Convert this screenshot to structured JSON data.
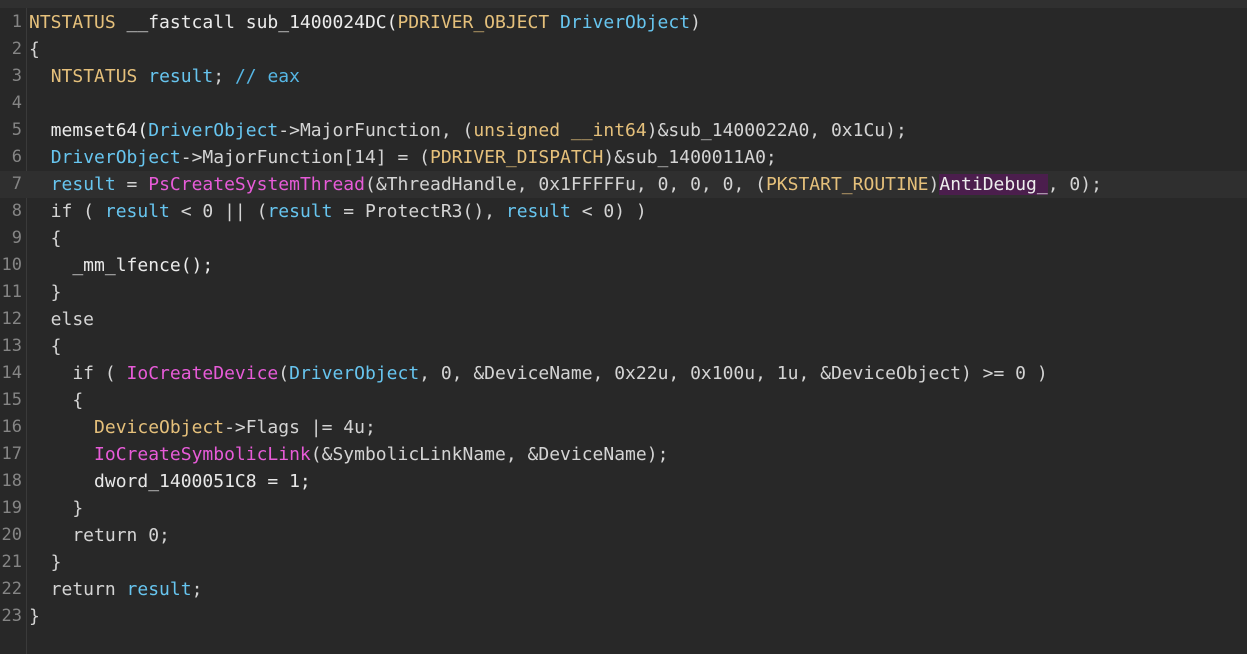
{
  "window": {
    "top_strip_text": "                  _                                                                 _                                                      ·                _             _"
  },
  "editor": {
    "current_line": 7,
    "colors": {
      "background": "#282828",
      "type": "#e5c07b",
      "local_variable": "#67c5ef",
      "import": "#e75bd8",
      "comment": "#56b6e4",
      "highlight": "#4b1e4d",
      "plain": "#d4d4d4"
    },
    "lines": [
      {
        "n": "1",
        "segs": [
          [
            "NTSTATUS",
            "typ"
          ],
          [
            " __fastcall sub_1400024DC(",
            "fn"
          ],
          [
            "PDRIVER_OBJECT",
            "typ"
          ],
          [
            " DriverObject",
            "arg"
          ],
          [
            ")",
            "pl"
          ]
        ]
      },
      {
        "n": "2",
        "segs": [
          [
            "{",
            "pl"
          ]
        ]
      },
      {
        "n": "3",
        "segs": [
          [
            "  ",
            "pl"
          ],
          [
            "NTSTATUS",
            "typ"
          ],
          [
            " result",
            "loc"
          ],
          [
            "; ",
            "pl"
          ],
          [
            "// eax",
            "cm"
          ]
        ]
      },
      {
        "n": "4",
        "segs": [
          [
            "",
            "pl"
          ]
        ]
      },
      {
        "n": "5",
        "segs": [
          [
            "  memset64(",
            "fn"
          ],
          [
            "DriverObject",
            "arg"
          ],
          [
            "->MajorFunction, (",
            "pl"
          ],
          [
            "unsigned __int64",
            "typ"
          ],
          [
            ")&sub_1400022A0, 0x1Cu);",
            "pl"
          ]
        ]
      },
      {
        "n": "6",
        "segs": [
          [
            "  ",
            "pl"
          ],
          [
            "DriverObject",
            "arg"
          ],
          [
            "->MajorFunction[14] = (",
            "pl"
          ],
          [
            "PDRIVER_DISPATCH",
            "typ"
          ],
          [
            ")&sub_1400011A0;",
            "pl"
          ]
        ]
      },
      {
        "n": "7",
        "segs": [
          [
            "  ",
            "pl"
          ],
          [
            "result",
            "loc"
          ],
          [
            " = ",
            "pl"
          ],
          [
            "PsCreateSystemThread",
            "imp"
          ],
          [
            "(&ThreadHandle, 0x1FFFFFu, 0, 0, 0, (",
            "pl"
          ],
          [
            "PKSTART_ROUTINE",
            "typ"
          ],
          [
            ")",
            "pl"
          ],
          [
            "AntiDebug_",
            "hl"
          ],
          [
            ", 0);",
            "pl"
          ]
        ]
      },
      {
        "n": "8",
        "segs": [
          [
            "  if ( ",
            "kw"
          ],
          [
            "result",
            "loc"
          ],
          [
            " < 0 || (",
            "pl"
          ],
          [
            "result",
            "loc"
          ],
          [
            " = ProtectR3(), ",
            "pl"
          ],
          [
            "result",
            "loc"
          ],
          [
            " < 0) )",
            "pl"
          ]
        ]
      },
      {
        "n": "9",
        "segs": [
          [
            "  {",
            "pl"
          ]
        ]
      },
      {
        "n": "10",
        "segs": [
          [
            "    _mm_lfence();",
            "fn"
          ]
        ]
      },
      {
        "n": "11",
        "segs": [
          [
            "  }",
            "pl"
          ]
        ]
      },
      {
        "n": "12",
        "segs": [
          [
            "  else",
            "kw"
          ]
        ]
      },
      {
        "n": "13",
        "segs": [
          [
            "  {",
            "pl"
          ]
        ]
      },
      {
        "n": "14",
        "segs": [
          [
            "    if ( ",
            "kw"
          ],
          [
            "IoCreateDevice",
            "imp"
          ],
          [
            "(",
            "pl"
          ],
          [
            "DriverObject",
            "arg"
          ],
          [
            ", 0, &DeviceName, 0x22u, 0x100u, 1u, &DeviceObject) >= 0 )",
            "pl"
          ]
        ]
      },
      {
        "n": "15",
        "segs": [
          [
            "    {",
            "pl"
          ]
        ]
      },
      {
        "n": "16",
        "segs": [
          [
            "      ",
            "pl"
          ],
          [
            "DeviceObject",
            "typ"
          ],
          [
            "->Flags |= 4u;",
            "pl"
          ]
        ]
      },
      {
        "n": "17",
        "segs": [
          [
            "      ",
            "pl"
          ],
          [
            "IoCreateSymbolicLink",
            "imp"
          ],
          [
            "(&SymbolicLinkName, &DeviceName);",
            "pl"
          ]
        ]
      },
      {
        "n": "18",
        "segs": [
          [
            "      dword_1400051C8 = 1;",
            "glob"
          ]
        ]
      },
      {
        "n": "19",
        "segs": [
          [
            "    }",
            "pl"
          ]
        ]
      },
      {
        "n": "20",
        "segs": [
          [
            "    return 0;",
            "kw"
          ]
        ]
      },
      {
        "n": "21",
        "segs": [
          [
            "  }",
            "pl"
          ]
        ]
      },
      {
        "n": "22",
        "segs": [
          [
            "  return ",
            "kw"
          ],
          [
            "result",
            "loc"
          ],
          [
            ";",
            "pl"
          ]
        ]
      },
      {
        "n": "23",
        "segs": [
          [
            "}",
            "pl"
          ]
        ]
      }
    ]
  }
}
